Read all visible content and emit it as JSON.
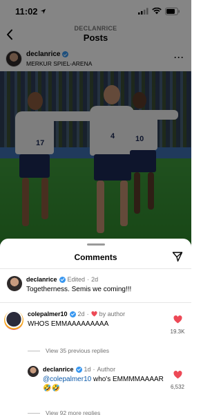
{
  "status_bar": {
    "time": "11:02"
  },
  "nav": {
    "username": "DECLANRICE",
    "title": "Posts"
  },
  "post": {
    "username": "declanrice",
    "location": "MERKUR SPIEL-ARENA",
    "jersey_numbers": [
      "17",
      "4",
      "10"
    ]
  },
  "comments_sheet": {
    "title": "Comments",
    "caption": {
      "username": "declanrice",
      "edited": "Edited",
      "age": "2d",
      "text": "Togetherness. Semis we coming!!!"
    },
    "comments": [
      {
        "username": "colepalmer10",
        "age": "2d",
        "author_like": "by author",
        "text": "WHOS EMMAAAAAAAAA",
        "likes": "19.3K",
        "view_replies": "View 35 previous replies",
        "reply": {
          "username": "declanrice",
          "age": "1d",
          "tag": "Author",
          "mention": "@colepalmer10",
          "text": " who's EMMMMAAAAR",
          "emoji": "🤣🤣",
          "likes": "6,532"
        },
        "view_more": "View 92 more replies"
      }
    ]
  },
  "colors": {
    "like_red": "#ed4956",
    "verified_blue": "#3897f0",
    "link_blue": "#0a58a8"
  }
}
